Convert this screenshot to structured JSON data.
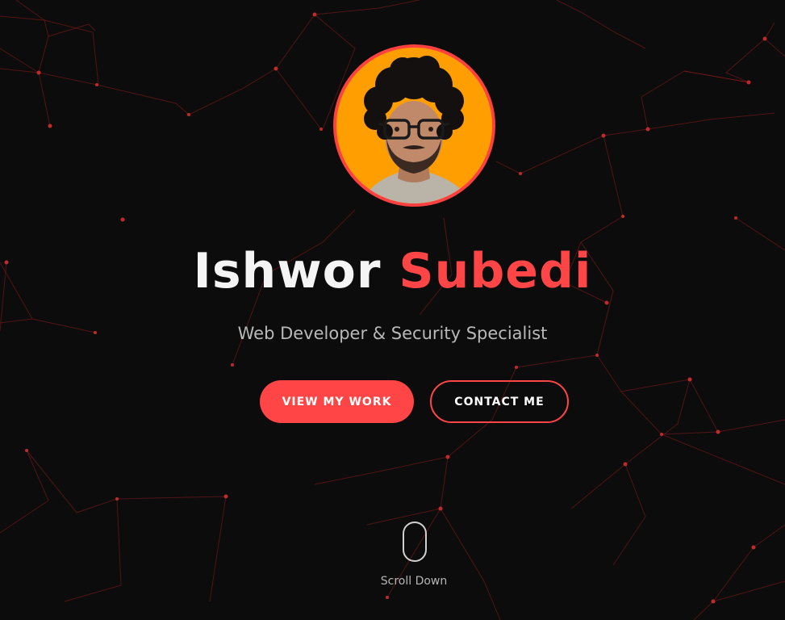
{
  "hero": {
    "name_first": "Ishwor",
    "name_last": "Subedi",
    "subtitle": "Web Developer & Security Specialist",
    "avatar_alt": "Profile photo"
  },
  "buttons": {
    "view_work": "VIEW MY WORK",
    "contact": "CONTACT ME"
  },
  "scroll": {
    "label": "Scroll Down",
    "icon": "mouse-scroll-icon"
  },
  "colors": {
    "background": "#0c0c0d",
    "accent": "#ff4545",
    "avatar_bg": "#ff9e00",
    "network": "#a52222"
  }
}
